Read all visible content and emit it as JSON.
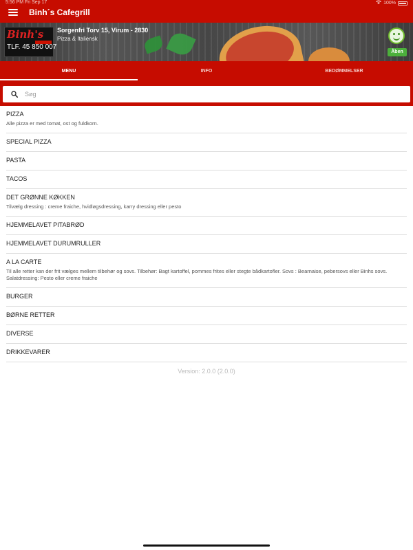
{
  "status_bar": {
    "time": "5:56 PM   Fri Sep 17",
    "battery": "100%"
  },
  "app_bar": {
    "title": "Binh´s Cafegrill"
  },
  "restaurant": {
    "logo_name": "Binh's",
    "logo_phone": "TLF. 45 850 007",
    "address": "Sorgenfri Torv 15, Virum - 2830",
    "cuisine": "Pizza & Italiensk",
    "status": "Åben"
  },
  "tabs": [
    {
      "label": "MENU",
      "active": true
    },
    {
      "label": "INFO",
      "active": false
    },
    {
      "label": "BEDØMMELSER",
      "active": false
    }
  ],
  "search": {
    "placeholder": "Søg",
    "value": ""
  },
  "menu": [
    {
      "title": "PIZZA",
      "desc": "Alle pizza er med tomat, ost og fuldkorn."
    },
    {
      "title": "SPECIAL PIZZA",
      "desc": ""
    },
    {
      "title": "PASTA",
      "desc": ""
    },
    {
      "title": "TACOS",
      "desc": ""
    },
    {
      "title": "DET GRØNNE KØKKEN",
      "desc": "Tilvælg dressing : creme fraiche, hvidløgsdressing, karry dressing eller pesto"
    },
    {
      "title": "HJEMMELAVET PITABRØD",
      "desc": ""
    },
    {
      "title": "HJEMMELAVET DURUMRULLER",
      "desc": ""
    },
    {
      "title": "A LA CARTE",
      "desc": "Til alle retter kan der frit vælges mellem tilbehør og sovs.  Tilbehør: Bagt kartoffel, pommes frites eller stegte bådkartofler. Sovs : Bearnaise, pebersovs eller Binhs sovs. Salatdressing: Pesto eller creme fraiche"
    },
    {
      "title": "BURGER",
      "desc": ""
    },
    {
      "title": "BØRNE RETTER",
      "desc": ""
    },
    {
      "title": "DIVERSE",
      "desc": ""
    },
    {
      "title": "DRIKKEVARER",
      "desc": ""
    }
  ],
  "footer": {
    "version": "Version: 2.0.0 (2.0.0)"
  },
  "colors": {
    "primary": "#c60c00",
    "open": "#4caf3c"
  }
}
